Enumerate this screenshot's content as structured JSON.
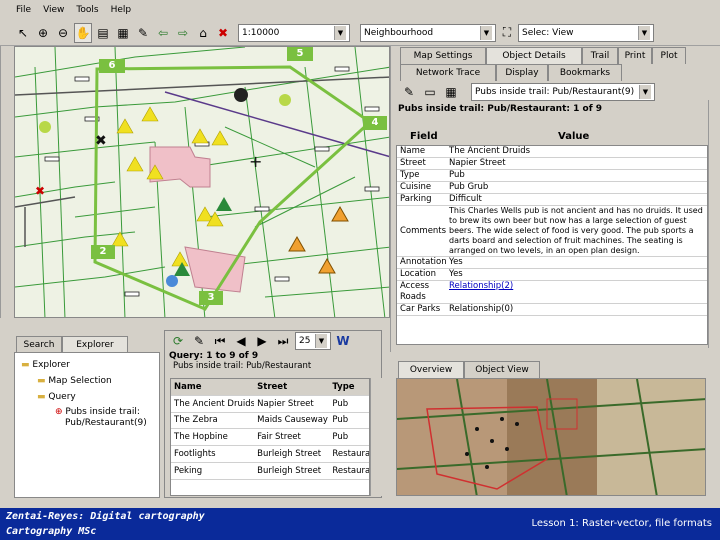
{
  "menu": {
    "items": [
      "File",
      "View",
      "Tools",
      "Help"
    ]
  },
  "toolbar": {
    "scale": "1:10000",
    "layer": "Neighbourhood",
    "select_mode": "Selec: View"
  },
  "map": {
    "markers": [
      "6",
      "5",
      "4",
      "2",
      "3"
    ]
  },
  "panel": {
    "tabs_row1": [
      "Map Settings",
      "Object Details",
      "Trail",
      "Print",
      "Plot"
    ],
    "tabs_row2": [
      "Network Trace",
      "Display",
      "Bookmarks"
    ],
    "dropdown": "Pubs inside trail: Pub/Restaurant(9)",
    "heading": "Pubs inside trail: Pub/Restaurant: 1 of 9",
    "col_field": "Field",
    "col_value": "Value",
    "rows": [
      {
        "f": "Name",
        "v": "The Ancient Druids"
      },
      {
        "f": "Street",
        "v": "Napier Street"
      },
      {
        "f": "Type",
        "v": "Pub"
      },
      {
        "f": "Cuisine",
        "v": "Pub Grub"
      },
      {
        "f": "Parking",
        "v": "Difficult"
      },
      {
        "f": "Comments",
        "v": "This Charles Wells pub is not ancient and has no druids. It used to brew its own beer but now has a large selection of guest beers. The wide select of food is very good. The pub sports a darts board and selection of fruit machines. The seating is arranged on two levels, in an open plan design."
      },
      {
        "f": "Annotation",
        "v": "Yes"
      },
      {
        "f": "Location",
        "v": "Yes"
      },
      {
        "f": "Access Roads",
        "v": "Relationship(2)"
      },
      {
        "f": "Car Parks",
        "v": "Relationship(0)"
      }
    ]
  },
  "explorer": {
    "tabs": [
      "Search",
      "Explorer"
    ],
    "tree": [
      "Explorer",
      "Map Selection",
      "Query",
      "Pubs inside trail:",
      "Pub/Restaurant(9)"
    ]
  },
  "query": {
    "page_size": "25",
    "title": "Query: 1 to 9 of 9",
    "group": "Pubs inside trail: Pub/Restaurant",
    "headers": [
      "Name",
      "Street",
      "Type"
    ],
    "rows": [
      [
        "The Ancient Druids",
        "Napier Street",
        "Pub"
      ],
      [
        "The Zebra",
        "Maids Causeway",
        "Pub"
      ],
      [
        "The Hopbine",
        "Fair Street",
        "Pub"
      ],
      [
        "Footlights",
        "Burleigh Street",
        "Restaurant"
      ],
      [
        "Peking",
        "Burleigh Street",
        "Restaurant"
      ]
    ]
  },
  "overview": {
    "tabs": [
      "Overview",
      "Object View"
    ]
  },
  "footer": {
    "left1": "Zentai-Reyes: Digital cartography",
    "left2": "Cartography MSc",
    "right": "Lesson 1: Raster-vector, file formats"
  }
}
